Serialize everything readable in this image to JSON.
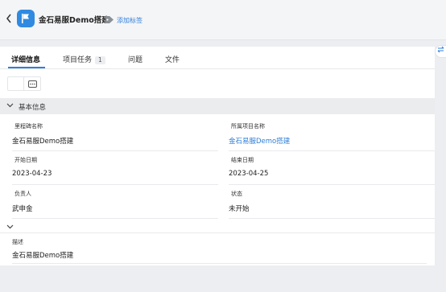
{
  "header": {
    "title": "金石易服Demo搭建",
    "add_tag_label": "添加标签"
  },
  "tabs": [
    {
      "label": "详细信息"
    },
    {
      "label": "项目任务",
      "badge": "1"
    },
    {
      "label": "问题"
    },
    {
      "label": "文件"
    }
  ],
  "section": {
    "title": "基本信息"
  },
  "fields": {
    "milestone_name": {
      "label": "里程碑名称",
      "value": "金石易服Demo搭建"
    },
    "project": {
      "label": "所属项目名称",
      "value": "金石易服Demo搭建"
    },
    "start_date": {
      "label": "开始日期",
      "value": "2023-04-23"
    },
    "end_date": {
      "label": "结束日期",
      "value": "2023-04-25"
    },
    "owner": {
      "label": "负责人",
      "value": "武申金"
    },
    "status": {
      "label": "状态",
      "value": "未开始"
    },
    "description": {
      "label": "描述",
      "value": "金石易服Demo搭建"
    }
  },
  "colors": {
    "accent": "#2f7fd8",
    "logo": "#2f8ae0"
  }
}
